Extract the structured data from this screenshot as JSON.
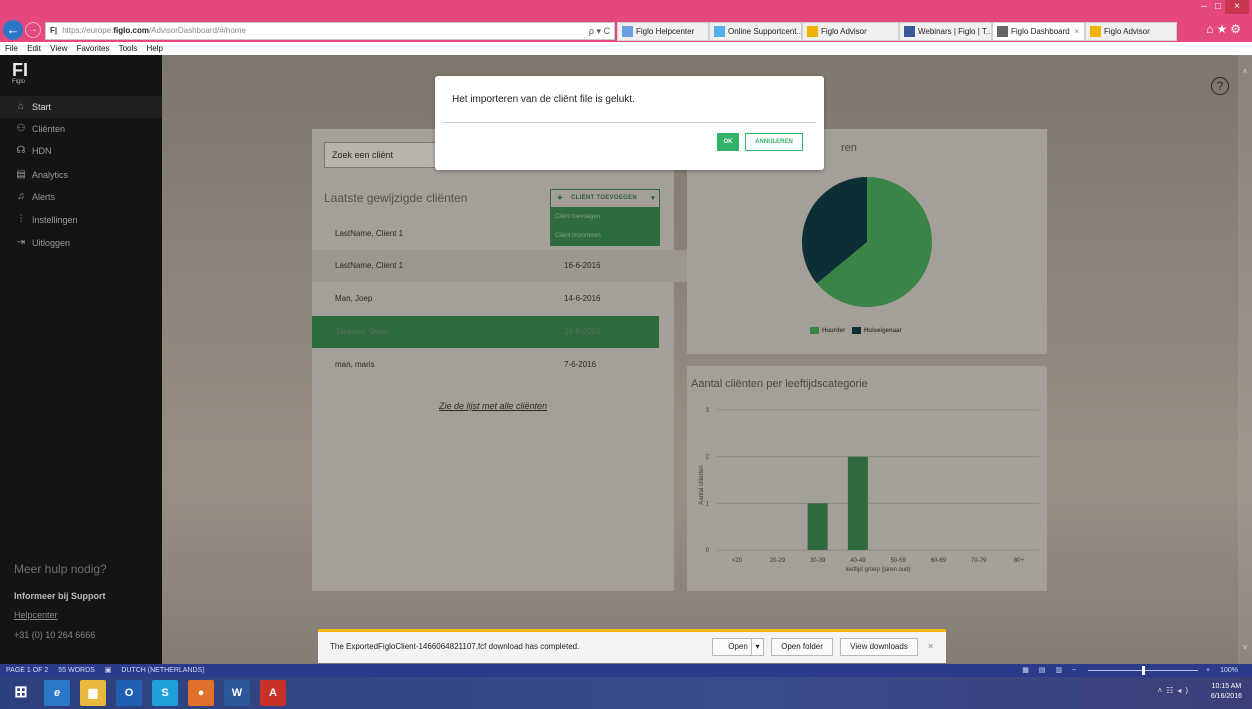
{
  "browser": {
    "url_prefix": "https://europe.",
    "url_domain": "figlo.com",
    "url_path": "/AdvisorDashboard/#/home",
    "address_tools": "ρ ▾ C",
    "tabs": [
      {
        "label": "Figlo Helpcenter",
        "icon_color": "#6aa0e0"
      },
      {
        "label": "Online Supportcent...",
        "icon_color": "#54b0e8"
      },
      {
        "label": "Figlo Advisor",
        "icon_color": "#f0b400"
      },
      {
        "label": "Webinars | Figlo | T...",
        "icon_color": "#3b5998"
      },
      {
        "label": "Figlo Dashboard",
        "icon_color": "#666666",
        "close": "×"
      },
      {
        "label": "Figlo Advisor",
        "icon_color": "#f0b400"
      }
    ],
    "menu": [
      "File",
      "Edit",
      "View",
      "Favorites",
      "Tools",
      "Help"
    ],
    "window_controls": [
      "–",
      "□",
      "×"
    ]
  },
  "sidebar": {
    "logo": "FI",
    "logo_sub": "Figlo",
    "items": [
      {
        "label": "Start",
        "icon": "home-icon",
        "glyph": "⌂"
      },
      {
        "label": "Cliënten",
        "icon": "clients-icon",
        "glyph": "⚇"
      },
      {
        "label": "HDN",
        "icon": "hdn-icon",
        "glyph": "☊"
      },
      {
        "label": "Analytics",
        "icon": "analytics-icon",
        "glyph": "▤"
      },
      {
        "label": "Alerts",
        "icon": "bell-icon",
        "glyph": "♫"
      },
      {
        "label": "Instellingen",
        "icon": "settings-icon",
        "glyph": "⫶"
      },
      {
        "label": "Uitloggen",
        "icon": "logout-icon",
        "glyph": "⇥"
      }
    ],
    "help_heading": "Meer hulp nodig?",
    "support": "Informeer bij Support",
    "helpcenter": "Helpcenter",
    "phone": "+31 (0) 10 264 6666"
  },
  "clients_panel": {
    "search_placeholder": "Zoek een cliënt",
    "title": "Laatste gewijzigde cliënten",
    "add_button": "CLIËNT TOEVOEGEN",
    "dropdown": [
      "Cliënt toevoegen",
      "Cliënt importeren"
    ],
    "rows": [
      {
        "name": "LastName, Client 1",
        "date": ""
      },
      {
        "name": "LastName, Client 1",
        "date": "16-6-2016"
      },
      {
        "name": "Man, Joep",
        "date": "14-6-2016"
      },
      {
        "name": "Janssen, Sven",
        "date": "14-6-2016"
      },
      {
        "name": "man, maris",
        "date": "7-6-2016"
      }
    ],
    "all_link": "Zie de lijst met alle cliënten"
  },
  "pie_panel": {
    "title_fragment": "ren"
  },
  "bar_panel": {
    "title": "Aantal cliënten per leeftijdscategorie"
  },
  "chart_data": [
    {
      "type": "pie",
      "categories": [
        "Huurder",
        "Huiseigenaar"
      ],
      "values": [
        64,
        36
      ],
      "colors": [
        "#3a8447",
        "#0c2f36"
      ],
      "legend": "bottom"
    },
    {
      "type": "bar",
      "categories": [
        "<20",
        "20-29",
        "30-39",
        "40-49",
        "50-59",
        "60-69",
        "70-79",
        "80+"
      ],
      "values": [
        0,
        0,
        1,
        2,
        0,
        0,
        0,
        0
      ],
      "title": "Aantal cliënten per leeftijdscategorie",
      "xlabel": "leeftijd groep (jaren oud)",
      "ylabel": "Aantal cliënten",
      "ylim": [
        0,
        3
      ],
      "yticks": [
        0,
        1,
        2,
        3
      ],
      "color": "#2f6a3e",
      "grid": true
    }
  ],
  "modal": {
    "message": "Het importeren van de cliënt file is gelukt.",
    "ok": "OK",
    "cancel": "ANNULEREN"
  },
  "download": {
    "message": "The ExportedFigloClient-1466064821107.fcf download has completed.",
    "open": "Open",
    "open_folder": "Open folder",
    "view_downloads": "View downloads",
    "close": "×"
  },
  "statusbar": {
    "page": "PAGE 1 OF 2",
    "words": "55 WORDS",
    "language": "DUTCH (NETHERLANDS)",
    "zoom": "100%"
  },
  "taskbar": {
    "apps": [
      {
        "name": "start-button",
        "glyph": "⊞",
        "color": "transparent"
      },
      {
        "name": "ie-app",
        "glyph": "e",
        "color": "#2c78c8"
      },
      {
        "name": "explorer-app",
        "glyph": "▆",
        "color": "#e8b93a"
      },
      {
        "name": "outlook-app",
        "glyph": "O",
        "color": "#1f5fb4"
      },
      {
        "name": "skype-app",
        "glyph": "S",
        "color": "#1ea0dc"
      },
      {
        "name": "firefox-app",
        "glyph": "●",
        "color": "#e0702a"
      },
      {
        "name": "word-app",
        "glyph": "W",
        "color": "#2b579a"
      },
      {
        "name": "acrobat-app",
        "glyph": "A",
        "color": "#c8302a"
      }
    ],
    "time": "10:15 AM",
    "date": "6/16/2016"
  },
  "colors": {
    "accent": "#32b36a",
    "sidebar": "#141414",
    "browser": "#e4487e"
  }
}
